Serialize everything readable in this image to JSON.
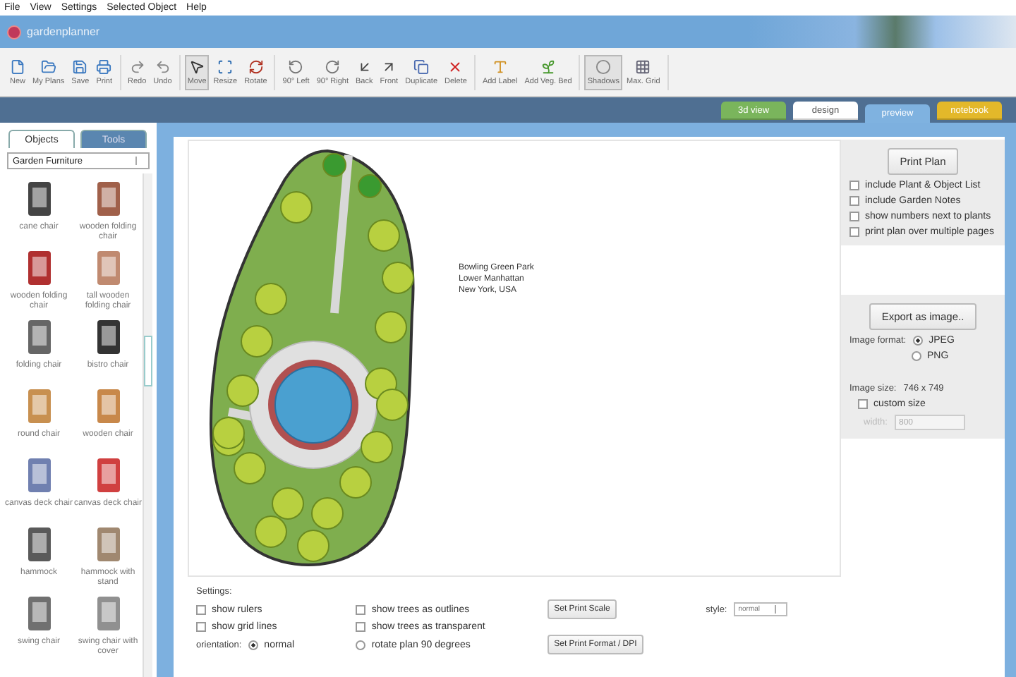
{
  "menu": [
    "File",
    "View",
    "Settings",
    "Selected Object",
    "Help"
  ],
  "app_title": "gardenplanner",
  "toolbar": [
    {
      "group": [
        {
          "label": "New",
          "pressed": false
        },
        {
          "label": "My Plans",
          "pressed": false
        },
        {
          "label": "Save",
          "pressed": false
        },
        {
          "label": "Print",
          "pressed": false
        }
      ]
    },
    {
      "group": [
        {
          "label": "Redo",
          "pressed": false
        },
        {
          "label": "Undo",
          "pressed": false
        }
      ]
    },
    {
      "group": [
        {
          "label": "Move",
          "pressed": true
        },
        {
          "label": "Resize",
          "pressed": false
        },
        {
          "label": "Rotate",
          "pressed": false
        }
      ]
    },
    {
      "group": [
        {
          "label": "90° Left",
          "pressed": false
        },
        {
          "label": "90° Right",
          "pressed": false
        },
        {
          "label": "Back",
          "pressed": false
        },
        {
          "label": "Front",
          "pressed": false
        },
        {
          "label": "Duplicate",
          "pressed": false
        },
        {
          "label": "Delete",
          "pressed": false
        }
      ]
    },
    {
      "group": [
        {
          "label": "Add Label",
          "pressed": false
        },
        {
          "label": "Add Veg. Bed",
          "pressed": false
        }
      ]
    },
    {
      "group": [
        {
          "label": "Shadows",
          "pressed": true
        },
        {
          "label": "Max. Grid",
          "pressed": false
        }
      ]
    }
  ],
  "view_tabs": [
    {
      "label": "3d view",
      "color": "#7ab55c",
      "selected": false
    },
    {
      "label": "design",
      "color": "#ffffff",
      "selected": false
    },
    {
      "label": "preview",
      "color": "#7fb2e0",
      "selected": true
    },
    {
      "label": "notebook",
      "color": "#e3b82a",
      "selected": false
    }
  ],
  "side_tabs": [
    {
      "label": "Objects",
      "selected": true
    },
    {
      "label": "Tools",
      "selected": false
    }
  ],
  "category": "Garden Furniture",
  "objects": [
    {
      "label": "cane chair",
      "color": "#444444"
    },
    {
      "label": "wooden folding chair",
      "color": "#a0604a"
    },
    {
      "label": "wooden folding chair",
      "color": "#b03030"
    },
    {
      "label": "tall wooden folding chair",
      "color": "#c08a70"
    },
    {
      "label": "folding chair",
      "color": "#666666"
    },
    {
      "label": "bistro chair",
      "color": "#333333"
    },
    {
      "label": "round chair",
      "color": "#c89050"
    },
    {
      "label": "wooden chair",
      "color": "#c8884a"
    },
    {
      "label": "canvas deck chair",
      "color": "#7080b0"
    },
    {
      "label": "canvas deck chair",
      "color": "#d04040"
    },
    {
      "label": "hammock",
      "color": "#5a5a5a"
    },
    {
      "label": "hammock with stand",
      "color": "#a08870"
    },
    {
      "label": "swing chair",
      "color": "#707070"
    },
    {
      "label": "swing chair with cover",
      "color": "#909090"
    }
  ],
  "address": [
    "Bowling Green Park",
    "Lower Manhattan",
    "New York, USA"
  ],
  "print_panel": {
    "button": "Print Plan",
    "options": [
      {
        "label": "include Plant & Object List",
        "checked": false
      },
      {
        "label": "include Garden Notes",
        "checked": false
      },
      {
        "label": "show numbers next to plants",
        "checked": false
      },
      {
        "label": "print plan over multiple pages",
        "checked": false
      }
    ]
  },
  "export_panel": {
    "button": "Export as image..",
    "format_label": "Image format:",
    "formats": [
      {
        "label": "JPEG",
        "selected": true
      },
      {
        "label": "PNG",
        "selected": false
      }
    ],
    "size_label": "Image size:",
    "size_value": "746 x 749",
    "custom_size": {
      "label": "custom size",
      "checked": false
    },
    "width_label": "width:",
    "width_value": "800"
  },
  "settings": {
    "title": "Settings:",
    "options": [
      {
        "label": "show rulers",
        "checked": false
      },
      {
        "label": "show trees as outlines",
        "checked": false
      },
      {
        "label": "show grid lines",
        "checked": false
      },
      {
        "label": "show trees as transparent",
        "checked": false
      }
    ],
    "orientation_label": "orientation:",
    "orientations": [
      {
        "label": "normal",
        "selected": true
      },
      {
        "label": "rotate plan 90 degrees",
        "selected": false
      }
    ],
    "scale_button": "Set Print Scale",
    "format_button": "Set Print Format / DPI",
    "style_label": "style:",
    "style_value": "normal"
  }
}
